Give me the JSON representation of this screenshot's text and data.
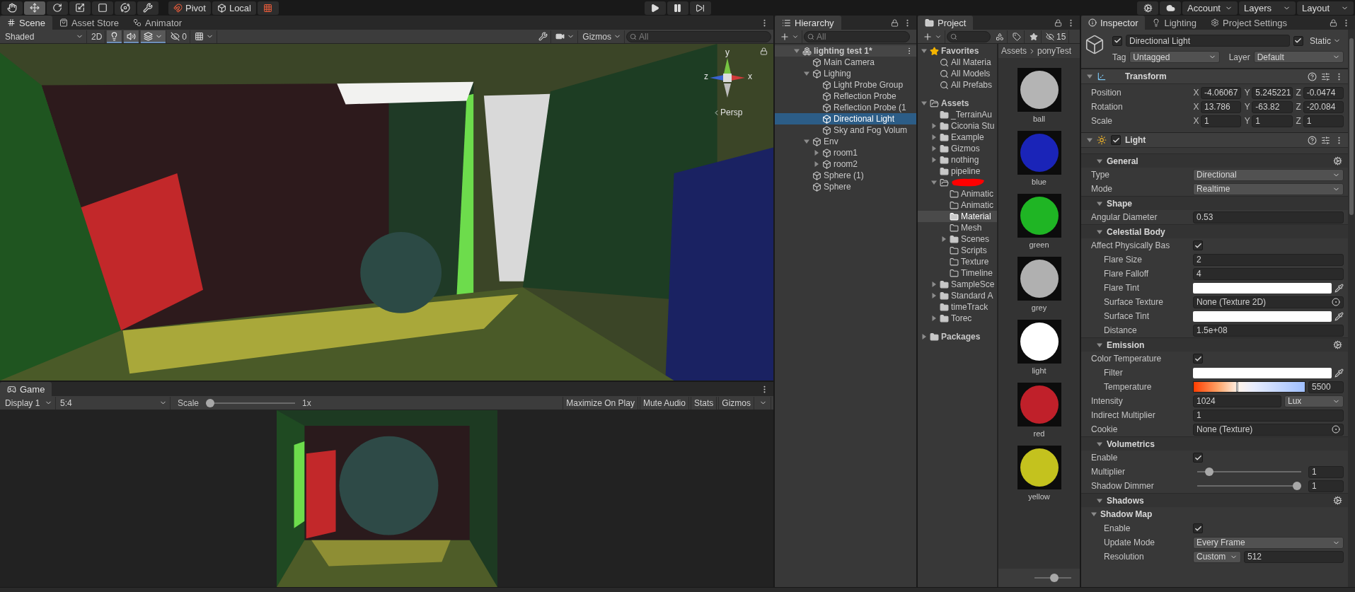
{
  "toolbar": {
    "tools": [
      {
        "kind": "hand",
        "selected": false
      },
      {
        "kind": "move",
        "selected": true
      },
      {
        "kind": "rotate",
        "selected": false
      },
      {
        "kind": "scale",
        "selected": false
      },
      {
        "kind": "rect",
        "selected": false
      },
      {
        "kind": "transform",
        "selected": false
      },
      {
        "kind": "custom",
        "selected": false
      }
    ],
    "pivot": "Pivot",
    "local": "Local",
    "account": "Account",
    "layers": "Layers",
    "layout": "Layout"
  },
  "scene": {
    "tabs": [
      {
        "kind": "scene",
        "label": "Scene",
        "selected": true
      },
      {
        "kind": "store",
        "label": "Asset Store",
        "selected": false
      },
      {
        "kind": "animator",
        "label": "Animator",
        "selected": false
      }
    ],
    "shading": "Shaded",
    "mode_2d": "2D",
    "toggles": [
      {
        "kind": "lighting",
        "on": true
      },
      {
        "kind": "audio",
        "on": true
      },
      {
        "kind": "effects",
        "on": true
      },
      {
        "kind": "visibility",
        "on": false
      },
      {
        "kind": "grid",
        "on": false
      }
    ],
    "hidden_count": "0",
    "gizmos": "Gizmos",
    "search_placeholder": "All",
    "axes": {
      "y": "y",
      "z": "z",
      "x": "x"
    },
    "projection": "Persp"
  },
  "game": {
    "tab": "Game",
    "display": "Display 1",
    "aspect": "5:4",
    "scale_label": "Scale",
    "scale": {
      "level": 0,
      "reading": "1x"
    },
    "buttons": [
      "Maximize On Play",
      "Mute Audio",
      "Stats",
      "Gizmos"
    ]
  },
  "hierarchy": {
    "title": "Hierarchy",
    "search_placeholder": "All",
    "scene": {
      "label": "lighting test 1*",
      "expanded": true,
      "selected": false,
      "children": [
        {
          "label": "Main Camera",
          "selected": false
        },
        {
          "label": "Lighing",
          "expanded": true,
          "selected": false,
          "children": [
            {
              "label": "Light Probe Group",
              "selected": false
            },
            {
              "label": "Reflection Probe",
              "selected": false
            },
            {
              "label": "Reflection Probe (1",
              "selected": false
            },
            {
              "label": "Directional Light",
              "selected": true
            },
            {
              "label": "Sky and Fog Volum",
              "selected": false
            }
          ]
        },
        {
          "label": "Env",
          "expanded": true,
          "selected": false,
          "children": [
            {
              "label": "room1",
              "expanded": false,
              "selected": false
            },
            {
              "label": "room2",
              "expanded": false,
              "selected": false
            }
          ]
        },
        {
          "label": "Sphere (1)",
          "selected": false
        },
        {
          "label": "Sphere",
          "selected": false
        }
      ]
    }
  },
  "project": {
    "title": "Project",
    "hidden_count": "15",
    "tree": [
      {
        "kind": "favorites",
        "label": "Favorites",
        "expanded": true,
        "selected": false,
        "children": [
          {
            "kind": "search",
            "label": "All Materia",
            "selected": false
          },
          {
            "kind": "search",
            "label": "All Models",
            "selected": false
          },
          {
            "kind": "search",
            "label": "All Prefabs",
            "selected": false
          }
        ]
      },
      {
        "kind": "root",
        "label": "Assets",
        "expanded": true,
        "selected": false,
        "children": [
          {
            "kind": "folder",
            "label": "_TerrainAu",
            "selected": false
          },
          {
            "kind": "folder",
            "label": "Ciconia Stu",
            "expanded": false,
            "selected": false
          },
          {
            "kind": "folder",
            "label": "Example",
            "expanded": false,
            "selected": false
          },
          {
            "kind": "folder",
            "label": "Gizmos",
            "expanded": false,
            "selected": false
          },
          {
            "kind": "folder",
            "label": "nothing",
            "expanded": false,
            "selected": false
          },
          {
            "kind": "folder",
            "label": "pipeline",
            "selected": false
          },
          {
            "kind": "redacted",
            "expanded": true,
            "selected": false,
            "children": [
              {
                "kind": "folder",
                "label": "Animatic",
                "empty": true,
                "selected": false
              },
              {
                "kind": "folder",
                "label": "Animatic",
                "empty": true,
                "selected": false
              },
              {
                "kind": "folder",
                "label": "Material",
                "selected": true
              },
              {
                "kind": "folder",
                "label": "Mesh",
                "empty": true,
                "selected": false
              },
              {
                "kind": "folder",
                "label": "Scenes",
                "expanded": false,
                "selected": false
              },
              {
                "kind": "folder",
                "label": "Scripts",
                "empty": true,
                "selected": false
              },
              {
                "kind": "folder",
                "label": "Texture",
                "empty": true,
                "selected": false
              },
              {
                "kind": "folder",
                "label": "Timeline",
                "empty": true,
                "selected": false
              }
            ]
          },
          {
            "kind": "folder",
            "label": "SampleSce",
            "expanded": false,
            "selected": false
          },
          {
            "kind": "folder",
            "label": "Standard A",
            "expanded": false,
            "selected": false
          },
          {
            "kind": "folder",
            "label": "timeTrack",
            "selected": false
          },
          {
            "kind": "folder",
            "label": "Torec",
            "expanded": false,
            "selected": false
          }
        ]
      },
      {
        "kind": "root",
        "label": "Packages",
        "expanded": false,
        "selected": false
      }
    ],
    "breadcrumb": [
      "Assets",
      "ponyTest"
    ],
    "materials": [
      {
        "label": "ball",
        "color": "#b4b4b4"
      },
      {
        "label": "blue",
        "color": "#1a24b8"
      },
      {
        "label": "green",
        "color": "#1fb524"
      },
      {
        "label": "grey",
        "color": "#b0b0b0"
      },
      {
        "label": "light",
        "color": "#ffffff"
      },
      {
        "label": "red",
        "color": "#c0202a"
      },
      {
        "label": "yellow",
        "color": "#c4c21e"
      }
    ],
    "zoom": {
      "level": 0.55
    }
  },
  "inspector": {
    "tabs": [
      {
        "kind": "info",
        "label": "Inspector",
        "selected": true
      },
      {
        "kind": "bulb",
        "label": "Lighting",
        "selected": false
      },
      {
        "kind": "gear",
        "label": "Project Settings",
        "selected": false
      }
    ],
    "object": {
      "active": true,
      "name": "Directional Light",
      "static": true,
      "static_label": "Static",
      "tag_label": "Tag",
      "tag": "Untagged",
      "layer_label": "Layer",
      "layer": "Default"
    },
    "transform": {
      "title": "Transform",
      "expanded": true,
      "rows": [
        {
          "label": "Position",
          "values": [
            {
              "axis": "X",
              "value": "-4.06067"
            },
            {
              "axis": "Y",
              "value": "5.245221"
            },
            {
              "axis": "Z",
              "value": "-0.0474"
            }
          ]
        },
        {
          "label": "Rotation",
          "values": [
            {
              "axis": "X",
              "value": "13.786"
            },
            {
              "axis": "Y",
              "value": "-63.82"
            },
            {
              "axis": "Z",
              "value": "-20.084"
            }
          ]
        },
        {
          "label": "Scale",
          "values": [
            {
              "axis": "X",
              "value": "1"
            },
            {
              "axis": "Y",
              "value": "1"
            },
            {
              "axis": "Z",
              "value": "1"
            }
          ]
        }
      ]
    },
    "light": {
      "title": "Light",
      "enabled": true,
      "expanded": true,
      "sections": [
        {
          "title": "General",
          "expanded": true,
          "settings": true,
          "rows": [
            {
              "kind": "dropdown",
              "label": "Type",
              "value": "Directional"
            },
            {
              "kind": "dropdown",
              "label": "Mode",
              "value": "Realtime"
            }
          ]
        },
        {
          "title": "Shape",
          "expanded": true,
          "settings": false,
          "rows": [
            {
              "kind": "number",
              "label": "Angular Diameter",
              "value": "0.53"
            }
          ]
        },
        {
          "title": "Celestial Body",
          "expanded": true,
          "settings": false,
          "rows": [
            {
              "kind": "checkbox",
              "label": "Affect Physically Bas",
              "checked": true,
              "children": [
                {
                  "kind": "number",
                  "label": "Flare Size",
                  "value": "2"
                },
                {
                  "kind": "number",
                  "label": "Flare Falloff",
                  "value": "4"
                },
                {
                  "kind": "color",
                  "label": "Flare Tint",
                  "color": "#ffffff"
                },
                {
                  "kind": "object",
                  "label": "Surface Texture",
                  "value": "None (Texture 2D)"
                },
                {
                  "kind": "color",
                  "label": "Surface Tint",
                  "color": "#ffffff"
                },
                {
                  "kind": "number",
                  "label": "Distance",
                  "value": "1.5e+08"
                }
              ]
            }
          ]
        },
        {
          "title": "Emission",
          "expanded": true,
          "settings": true,
          "rows": [
            {
              "kind": "checkbox",
              "label": "Color Temperature",
              "checked": true,
              "children": [
                {
                  "kind": "color",
                  "label": "Filter",
                  "color": "#ffffff"
                },
                {
                  "kind": "temperature",
                  "label": "Temperature",
                  "level": 0.39,
                  "value": "5500"
                }
              ]
            },
            {
              "kind": "number_unit",
              "label": "Intensity",
              "value": "1024",
              "unit": "Lux"
            },
            {
              "kind": "number",
              "label": "Indirect Multiplier",
              "value": "1"
            },
            {
              "kind": "object",
              "label": "Cookie",
              "value": "None (Texture)"
            }
          ]
        },
        {
          "title": "Volumetrics",
          "expanded": true,
          "settings": false,
          "rows": [
            {
              "kind": "checkbox",
              "label": "Enable",
              "checked": true
            },
            {
              "kind": "slider",
              "label": "Multiplier",
              "level": 0.08,
              "value": "1"
            },
            {
              "kind": "slider",
              "label": "Shadow Dimmer",
              "level": 1,
              "value": "1"
            }
          ]
        },
        {
          "title": "Shadows",
          "expanded": true,
          "settings": true,
          "rows": [
            {
              "kind": "group",
              "label": "Shadow Map",
              "expanded": true,
              "children": [
                {
                  "kind": "checkbox",
                  "label": "Enable",
                  "checked": true
                },
                {
                  "kind": "dropdown",
                  "label": "Update Mode",
                  "value": "Every Frame"
                },
                {
                  "kind": "dropdown_number",
                  "label": "Resolution",
                  "option": "Custom",
                  "value": "512"
                }
              ]
            }
          ]
        }
      ]
    }
  }
}
